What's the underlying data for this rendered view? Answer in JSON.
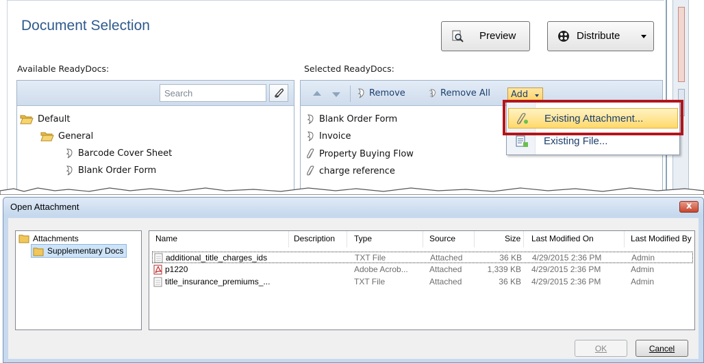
{
  "document_selection": {
    "title": "Document Selection",
    "preview_label": "Preview",
    "distribute_label": "Distribute",
    "available_label": "Available ReadyDocs:",
    "selected_label": "Selected ReadyDocs:",
    "search_placeholder": "Search",
    "available_tree": [
      {
        "label": "Default",
        "type": "folder"
      },
      {
        "label": "General",
        "type": "folder"
      },
      {
        "label": "Barcode Cover Sheet",
        "type": "doc"
      },
      {
        "label": "Blank Order Form",
        "type": "doc"
      }
    ],
    "selected_toolbar": {
      "remove_label": "Remove",
      "remove_all_label": "Remove All",
      "add_label": "Add"
    },
    "selected_items": [
      {
        "label": "Blank Order Form",
        "icon": "doc-icon"
      },
      {
        "label": "Invoice",
        "icon": "doc-icon"
      },
      {
        "label": "Property Buying Flow",
        "icon": "paperclip-icon"
      },
      {
        "label": "charge reference",
        "icon": "paperclip-icon"
      }
    ],
    "add_menu": [
      {
        "label": "Existing Attachment...",
        "icon": "attachment-icon",
        "highlighted": true
      },
      {
        "label": "Existing File...",
        "icon": "file-add-icon",
        "highlighted": false
      }
    ],
    "highlight_color": "#b3151b"
  },
  "dialog": {
    "title": "Open Attachment",
    "close_label": "x",
    "folders": [
      {
        "label": "Attachments"
      },
      {
        "label": "Supplementary Docs",
        "selected": true
      }
    ],
    "columns": [
      "Name",
      "Description",
      "Type",
      "Source",
      "Size",
      "Last Modified On",
      "Last Modified By"
    ],
    "files": [
      {
        "name": "additional_title_charges_ids",
        "description": "",
        "type": "TXT File",
        "source": "Attached",
        "size": "36 KB",
        "modified_on": "4/29/2015 2:36 PM",
        "modified_by": "Admin",
        "icon": "text-file-icon"
      },
      {
        "name": "p1220",
        "description": "",
        "type": "Adobe Acrob...",
        "source": "Attached",
        "size": "1,339 KB",
        "modified_on": "4/29/2015 2:36 PM",
        "modified_by": "Admin",
        "icon": "pdf-icon"
      },
      {
        "name": "title_insurance_premiums_...",
        "description": "",
        "type": "TXT File",
        "source": "Attached",
        "size": "36 KB",
        "modified_on": "4/29/2015 2:36 PM",
        "modified_by": "Admin",
        "icon": "text-file-icon"
      }
    ],
    "ok_label": "OK",
    "cancel_label": "Cancel"
  }
}
